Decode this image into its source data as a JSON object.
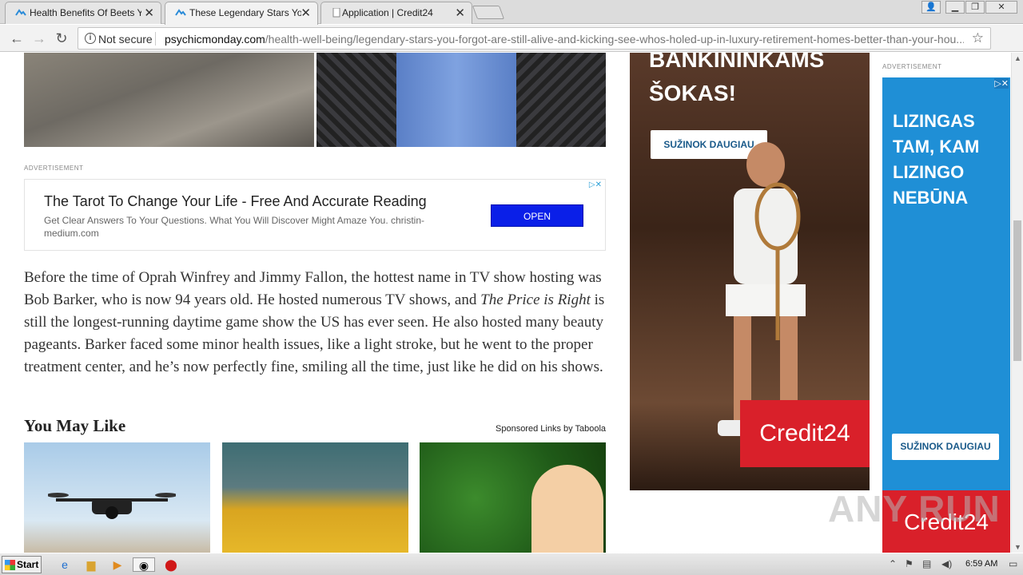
{
  "browser": {
    "tabs": [
      {
        "title": "Health Benefits Of Beets Yo",
        "active": false
      },
      {
        "title": "These Legendary Stars You",
        "active": true
      },
      {
        "title": "Application | Credit24",
        "active": false
      }
    ],
    "security_label": "Not secure",
    "url_domain": "psychicmonday.com",
    "url_path": "/health-well-being/legendary-stars-you-forgot-are-still-alive-and-kicking-see-whos-holed-up-in-luxury-retirement-homes-better-than-your-hou..."
  },
  "article": {
    "ad_label": "ADVERTISEMENT",
    "ad": {
      "title": "The Tarot To Change Your Life - Free And Accurate Reading",
      "description": "Get Clear Answers To Your Questions. What You Will Discover Might Amaze You. christin-medium.com",
      "button": "OPEN"
    },
    "paragraph_part1": "Before the time of Oprah Winfrey and Jimmy Fallon, the hottest name in TV show hosting was Bob Barker, who is now 94 years old. He hosted numerous TV shows, and ",
    "paragraph_italic": "The Price is Right",
    "paragraph_part2": " is still the longest-running daytime game show the US has ever seen. He also hosted many beauty pageants. Barker faced some minor health issues, like a light stroke, but he went to the proper treatment center, and he’s now perfectly fine, smiling all the time, just like he did on his shows.",
    "you_may_like": "You May Like",
    "sponsored": "Sponsored Links by Taboola"
  },
  "sidebar": {
    "ad1": {
      "headline_line1": "BANKININKAMS",
      "headline_line2": "ŠOKAS!",
      "cta": "SUŽINOK DAUGIAU",
      "logo": "Credit24"
    },
    "ad2_label": "ADVERTISEMENT",
    "ad2": {
      "headline": "LIZINGAS TAM, KAM LIZINGO NEBŪNA",
      "cta": "SUŽINOK DAUGIAU",
      "logo": "Credit24"
    }
  },
  "watermark": "ANY RUN",
  "taskbar": {
    "start": "Start",
    "clock": "6:59 AM"
  },
  "colors": {
    "open_button": "#0a1fe8",
    "credit24_red": "#d9202a",
    "ad2_blue": "#1f8fd6"
  }
}
